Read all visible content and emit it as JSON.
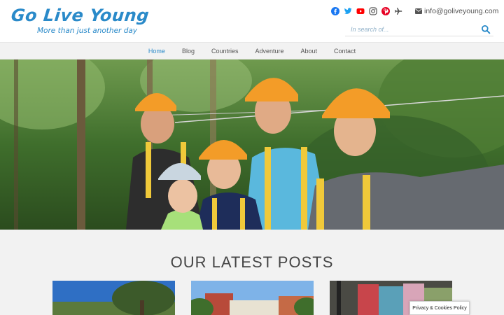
{
  "brand": {
    "title": "Go Live Young",
    "tagline": "More than just another day",
    "accent": "#2a8ac9"
  },
  "social_icons": [
    {
      "icon": "facebook-icon",
      "color": "#1877f2"
    },
    {
      "icon": "twitter-icon",
      "color": "#1da1f2"
    },
    {
      "icon": "youtube-icon",
      "color": "#ff0000"
    },
    {
      "icon": "instagram-icon",
      "color": "#555555"
    },
    {
      "icon": "pinterest-icon",
      "color": "#e60023"
    },
    {
      "icon": "airplane-icon",
      "color": "#555555"
    }
  ],
  "contact": {
    "icon": "envelope-icon",
    "email": "info@goliveyoung.com"
  },
  "search": {
    "placeholder": "In search of...",
    "icon": "search-icon"
  },
  "nav": {
    "items": [
      "Home",
      "Blog",
      "Countries",
      "Adventure",
      "About",
      "Contact"
    ],
    "active": "Home"
  },
  "hero": {
    "image": "family-ziplining-photo"
  },
  "latest_posts": {
    "heading": "OUR LATEST POSTS",
    "cards": [
      {
        "image": "tree-sky-photo"
      },
      {
        "image": "city-buildings-photo"
      },
      {
        "image": "colorful-wall-photo"
      }
    ]
  },
  "privacy_button": {
    "label": "Privacy & Cookies Policy"
  }
}
